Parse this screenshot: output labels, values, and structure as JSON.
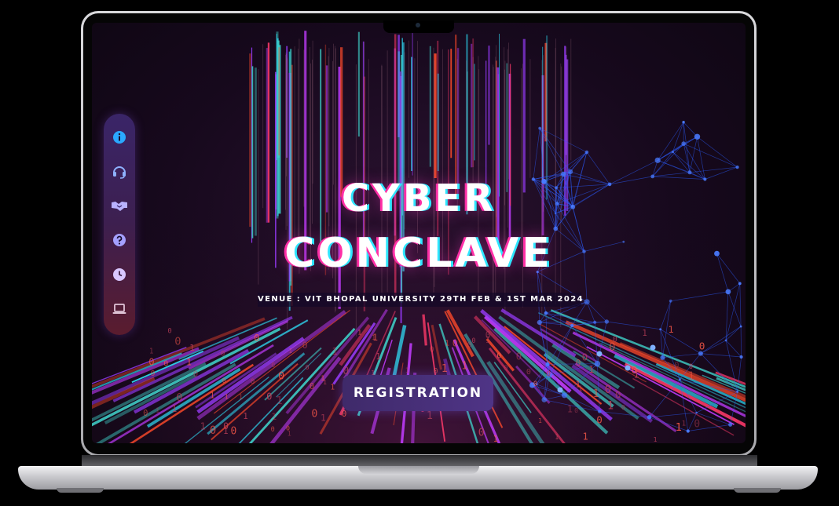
{
  "hero": {
    "title_line1": "CYBER",
    "title_line2": "CONCLAVE",
    "venue": "VENUE : VIT BHOPAL UNIVERSITY  29TH FEB & 1ST MAR 2024"
  },
  "cta": {
    "label": "REGISTRATION"
  },
  "sidebar": {
    "items": [
      {
        "icon": "info-icon",
        "color": "#2aa8ff"
      },
      {
        "icon": "headset-icon",
        "color": "#8fb2ff"
      },
      {
        "icon": "handshake-icon",
        "color": "#b9b2ff"
      },
      {
        "icon": "question-icon",
        "color": "#a4a0ff"
      },
      {
        "icon": "clock-icon",
        "color": "#d9c8ff"
      },
      {
        "icon": "laptop-icon",
        "color": "#e0c4d6"
      }
    ]
  },
  "theme": {
    "accent_pink": "#ff2fa6",
    "accent_cyan": "#2fe6ff",
    "network_blue": "#2b5cff",
    "background": "#17091d"
  }
}
